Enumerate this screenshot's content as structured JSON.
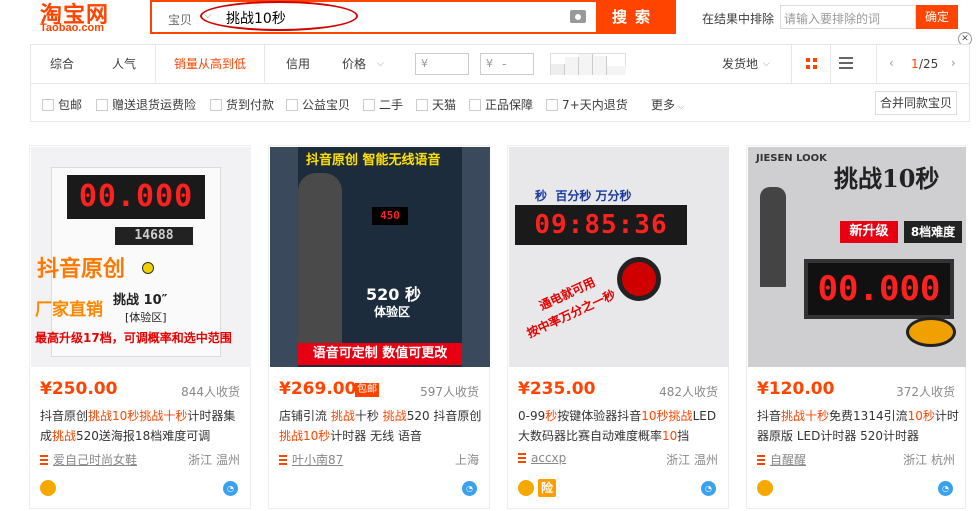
{
  "header": {
    "logo_text": "淘宝网",
    "logo_sub": "Taobao.com",
    "search_type": "宝贝",
    "search_query": "挑战10秒",
    "search_button": "搜索",
    "exclude_label": "在结果中排除",
    "exclude_placeholder": "请输入要排除的词",
    "exclude_button": "确定"
  },
  "sort": {
    "tabs": [
      "综合",
      "人气",
      "销量从高到低",
      "信用",
      "价格"
    ],
    "price_min_placeholder": "¥",
    "price_max_placeholder": "¥",
    "ship_from": "发货地",
    "page": "1",
    "total_pages": "/25"
  },
  "filters": {
    "items": [
      "包邮",
      "赠送退货运费险",
      "货到付款",
      "公益宝贝",
      "二手",
      "天猫",
      "正品保障",
      "7+天内退货"
    ],
    "more": "更多",
    "same_button": "合并同款宝贝"
  },
  "products": [
    {
      "price": "¥250.00",
      "sales": "844人收货",
      "title_parts": [
        "抖音原创",
        "挑战",
        "10秒",
        "挑战",
        "十秒",
        "计时器集成",
        "挑战",
        "520送海报18档难度可调"
      ],
      "shop": "爱自己时尚女鞋",
      "location": "浙江 温州",
      "free_post": "",
      "image_texts": {
        "led": "00.000",
        "led2": "14688",
        "t1": "抖音原创",
        "t2": "厂家直销",
        "t3": "挑战 10″",
        "t4": "[体验区]",
        "t5": "最高升级17档，可调概率和选中范围"
      }
    },
    {
      "price": "¥269.00",
      "sales": "597人收货",
      "title_parts": [
        "店铺引流 ",
        "挑战",
        "十秒 ",
        "挑战",
        "520 抖音原创 ",
        "挑战",
        "10秒",
        "计时器 无线 语音"
      ],
      "shop": "叶小南87",
      "location": "上海",
      "free_post": "包邮",
      "image_texts": {
        "t1": "抖音原创 智能无线语音",
        "led": "450",
        "t2": "520 秒",
        "t3": "体验区",
        "t4": "语音可定制 数值可更改"
      }
    },
    {
      "price": "¥235.00",
      "sales": "482人收货",
      "title_parts": [
        "0-99",
        "秒",
        "按键体验器抖音",
        "10秒",
        "挑战",
        "LED大数码器比赛自动难度概率",
        "10",
        "挡"
      ],
      "shop": "accxp",
      "location": "浙江 温州",
      "free_post": "",
      "image_texts": {
        "labels": "秒  百分秒 万分秒",
        "led": "09:85:36",
        "t1": "通电就可用",
        "t2": "按中率万分之一秒"
      }
    },
    {
      "price": "¥120.00",
      "sales": "372人收货",
      "title_parts": [
        "抖音",
        "挑战",
        "十秒",
        "免费1314引流",
        "10秒",
        "计时器原版 LED计时器 520计时器"
      ],
      "shop": "自醒醒",
      "location": "浙江 杭州",
      "free_post": "",
      "image_texts": {
        "brand": "JIESEN LOOK",
        "t1": "挑战10秒",
        "t2": "新升级",
        "t3": "8档难度",
        "led": "00.000"
      }
    }
  ],
  "colors": {
    "accent": "#ff4400",
    "led": "#ff2020",
    "link": "#3aa0f0"
  }
}
